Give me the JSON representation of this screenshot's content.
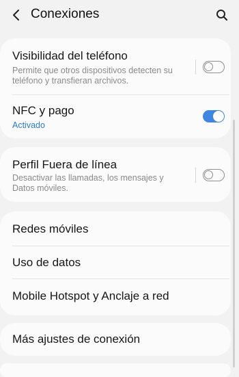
{
  "header": {
    "title": "Conexiones",
    "back_icon": "back-arrow-icon",
    "search_icon": "search-icon"
  },
  "group1": {
    "phone_visibility": {
      "title": "Visibilidad del teléfono",
      "subtitle": "Permite que otros dispositivos detecten su teléfono y transfieran archivos.",
      "toggle_on": false
    },
    "nfc": {
      "title": "NFC y pago",
      "subtitle": "Activado",
      "toggle_on": true
    }
  },
  "group2": {
    "offline_profile": {
      "title": "Perfil Fuera de línea",
      "subtitle": "Desactivar las llamadas, los mensajes y Datos móviles.",
      "toggle_on": false
    }
  },
  "group3": {
    "items": [
      {
        "label": "Redes móviles"
      },
      {
        "label": "Uso de datos"
      },
      {
        "label": "Mobile Hotspot y Anclaje a red"
      }
    ]
  },
  "group4": {
    "more_settings": {
      "label": "Más ajustes de conexión"
    }
  },
  "colors": {
    "background": "#f2f2f2",
    "card": "#fbfbfb",
    "accent": "#3e86e0",
    "subtitle": "#8a8a8a",
    "active_subtitle": "#2a7ad0"
  }
}
